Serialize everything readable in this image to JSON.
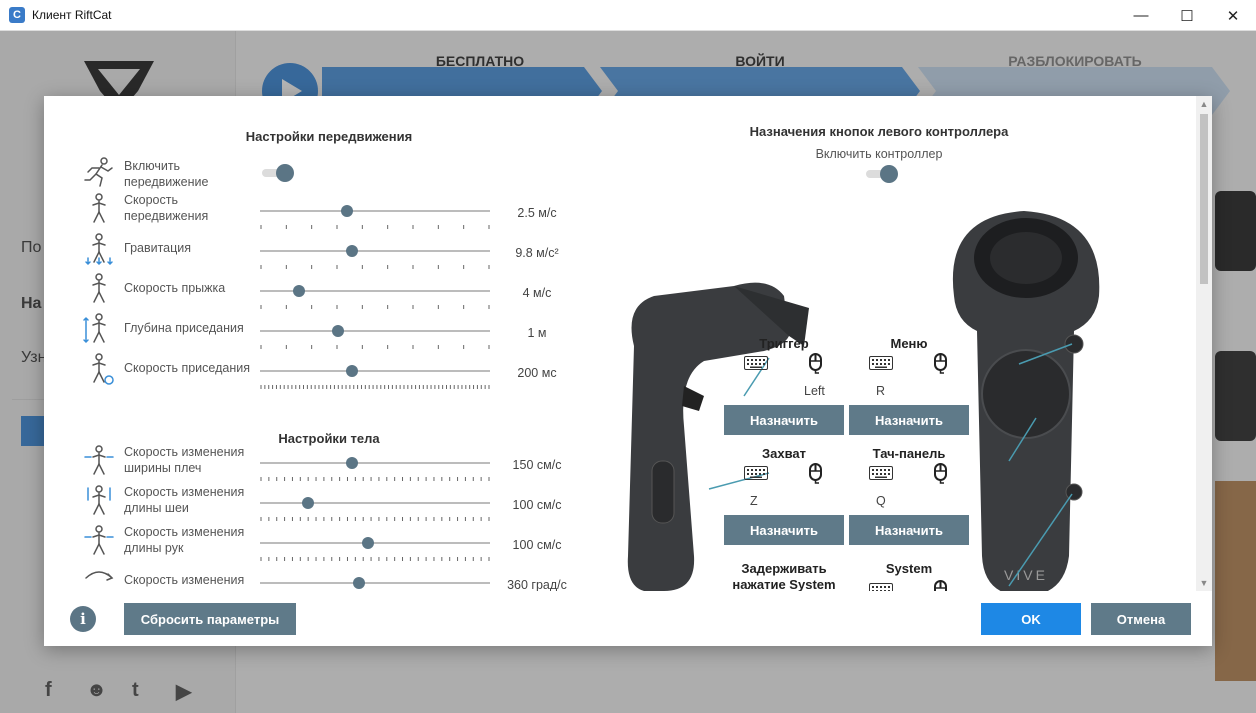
{
  "window": {
    "title": "Клиент RiftCat",
    "app_icon_glyph": "C",
    "controls": {
      "minimize": "—",
      "maximize": "☐",
      "close": "✕"
    }
  },
  "background": {
    "steps": [
      "БЕСПЛАТНО",
      "ВОЙТИ",
      "РАЗБЛОКИРОВАТЬ"
    ],
    "sidebar_nav": [
      "По",
      "На",
      "Узн"
    ],
    "social": [
      "f",
      "☻",
      "t",
      "▶"
    ]
  },
  "movement": {
    "title": "Настройки передвижения",
    "enable_label": "Включить передвижение",
    "enable_on": true,
    "sliders": [
      {
        "label": "Скорость передвижения",
        "value": "2.5 м/с",
        "position": 0.38,
        "icon": "walking-icon"
      },
      {
        "label": "Гравитация",
        "value": "9.8 м/с²",
        "position": 0.4,
        "icon": "gravity-icon"
      },
      {
        "label": "Скорость прыжка",
        "value": "4 м/с",
        "position": 0.17,
        "icon": "jump-icon"
      },
      {
        "label": "Глубина приседания",
        "value": "1 м",
        "position": 0.34,
        "icon": "crouch-depth-icon"
      },
      {
        "label": "Скорость приседания",
        "value": "200 мс",
        "position": 0.4,
        "icon": "crouch-speed-icon"
      }
    ]
  },
  "body": {
    "title": "Настройки тела",
    "sliders": [
      {
        "label": "Скорость изменения ширины плеч",
        "value": "150 см/с",
        "position": 0.4,
        "icon": "shoulder-width-icon"
      },
      {
        "label": "Скорость изменения длины шеи",
        "value": "100 см/с",
        "position": 0.21,
        "icon": "neck-length-icon"
      },
      {
        "label": "Скорость изменения длины рук",
        "value": "100 см/с",
        "position": 0.47,
        "icon": "arm-length-icon"
      },
      {
        "label": "Скорость изменения",
        "value": "360 град/с",
        "position": 0.43,
        "icon": "rotation-icon"
      }
    ]
  },
  "controller": {
    "title": "Назначения кнопок левого контроллера",
    "enable_label": "Включить контроллер",
    "enable_on": true,
    "brand": "VIVE",
    "bindings": [
      {
        "label": "Триггер",
        "value": "Left",
        "button": "Назначить"
      },
      {
        "label": "Меню",
        "value": "R",
        "button": "Назначить"
      },
      {
        "label": "Захват",
        "value": "Z",
        "button": "Назначить"
      },
      {
        "label": "Тач-панель",
        "value": "Q",
        "button": "Назначить"
      },
      {
        "label": "Задерживать нажатие System на",
        "value": "",
        "button": ""
      },
      {
        "label": "System",
        "value": "",
        "button": ""
      }
    ]
  },
  "footer": {
    "info": "i",
    "reset": "Сбросить параметры",
    "ok": "OK",
    "cancel": "Отмена"
  },
  "colors": {
    "accent": "#1e88e5",
    "button": "#5f7a89",
    "knob": "#5b7585"
  }
}
